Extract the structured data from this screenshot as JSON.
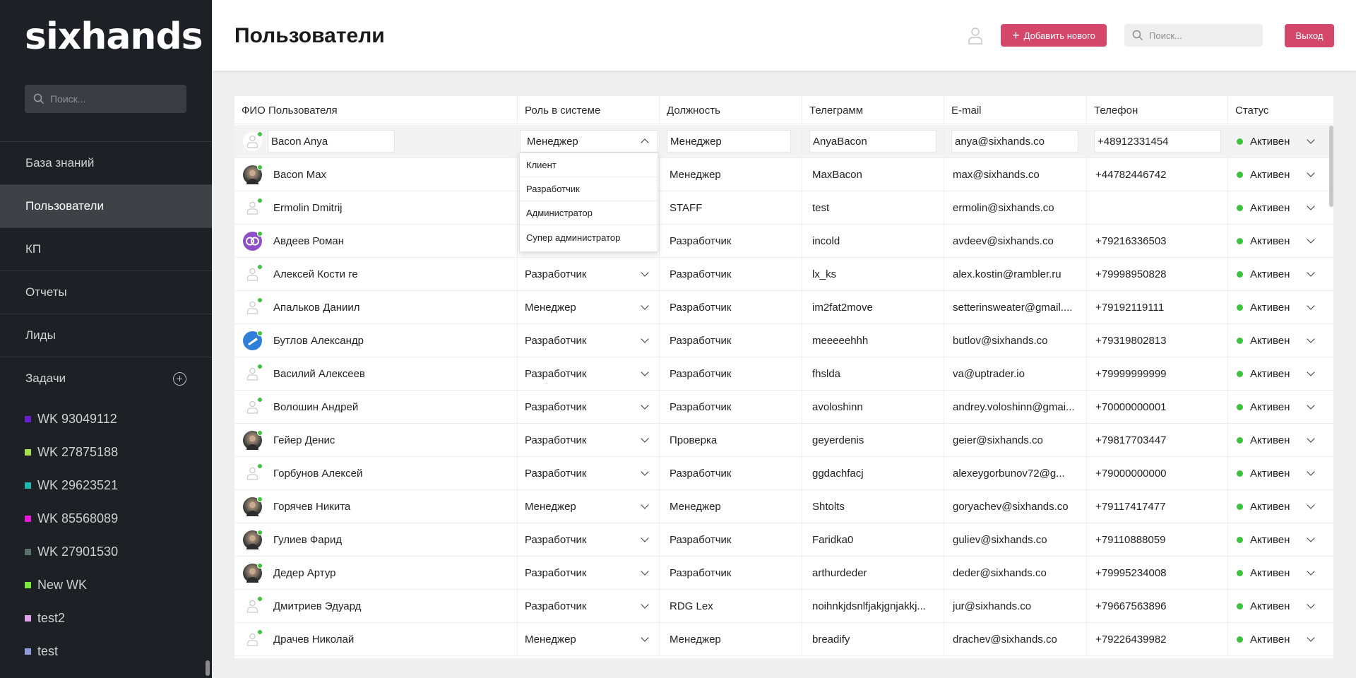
{
  "sidebar": {
    "logo": "sixhands",
    "search_placeholder": "Поиск...",
    "nav": [
      {
        "label": "База знаний",
        "active": false
      },
      {
        "label": "Пользователи",
        "active": true
      },
      {
        "label": "КП",
        "active": false
      },
      {
        "label": "Отчеты",
        "active": false
      },
      {
        "label": "Лиды",
        "active": false
      },
      {
        "label": "Задачи",
        "active": false
      }
    ],
    "tasks": [
      {
        "label": "WK 93049112",
        "color": "#6a1fd1"
      },
      {
        "label": "WK 27875188",
        "color": "#a7e04a"
      },
      {
        "label": "WK 29623521",
        "color": "#1fb5b0"
      },
      {
        "label": "WK 85568089",
        "color": "#e81ad9"
      },
      {
        "label": "WK 27901530",
        "color": "#5a7368"
      },
      {
        "label": "New WK",
        "color": "#7be83a"
      },
      {
        "label": "test2",
        "color": "#e0a3e8"
      },
      {
        "label": "test",
        "color": "#8e9bdc"
      }
    ]
  },
  "header": {
    "title": "Пользователи",
    "add_label": "Добавить нового",
    "search_placeholder": "Поиск...",
    "exit_label": "Выход",
    "accent": "#d5476a"
  },
  "table": {
    "columns": [
      "ФИО Пользователя",
      "Роль в системе",
      "Должность",
      "Телеграмм",
      "E-mail",
      "Телефон",
      "Статус"
    ],
    "rows": [
      {
        "name": "Bacon Anya",
        "role": "Менеджер",
        "position": "Менеджер",
        "telegram": "AnyaBacon",
        "email": "anya@sixhands.co",
        "phone": "+48912331454",
        "status": "Активен",
        "avatar": "blank"
      },
      {
        "name": "Bacon Max",
        "role": "",
        "position": "Менеджер",
        "telegram": "MaxBacon",
        "email": "max@sixhands.co",
        "phone": "+44782446742",
        "status": "Активен",
        "avatar": "photo"
      },
      {
        "name": "Ermolin Dmitrij",
        "role": "",
        "position": "STAFF",
        "telegram": "test",
        "email": "ermolin@sixhands.co",
        "phone": "",
        "status": "Активен",
        "avatar": "blank"
      },
      {
        "name": "Авдеев Роман",
        "role": "",
        "position": "Разработчик",
        "telegram": "incold",
        "email": "avdeev@sixhands.co",
        "phone": "+79216336503",
        "status": "Активен",
        "avatar": "logo"
      },
      {
        "name": "Алексей Кости ге",
        "role": "Разработчик",
        "position": "Разработчик",
        "telegram": "lx_ks",
        "email": "alex.kostin@rambler.ru",
        "phone": "+79998950828",
        "status": "Активен",
        "avatar": "blank"
      },
      {
        "name": "Апальков Даниил",
        "role": "Менеджер",
        "position": "Разработчик",
        "telegram": "im2fat2move",
        "email": "setterinsweater@gmail....",
        "phone": "+79192119111",
        "status": "Активен",
        "avatar": "blank"
      },
      {
        "name": "Бутлов Александр",
        "role": "Разработчик",
        "position": "Разработчик",
        "telegram": "meeeeehhh",
        "email": "butlov@sixhands.co",
        "phone": "+79319802813",
        "status": "Активен",
        "avatar": "blue"
      },
      {
        "name": "Василий Алексеев",
        "role": "Разработчик",
        "position": "Разработчик",
        "telegram": "fhslda",
        "email": "va@uptrader.io",
        "phone": "+79999999999",
        "status": "Активен",
        "avatar": "blank"
      },
      {
        "name": "Волошин Андрей",
        "role": "Разработчик",
        "position": "Разработчик",
        "telegram": "avoloshinn",
        "email": "andrey.voloshinn@gmai...",
        "phone": "+70000000001",
        "status": "Активен",
        "avatar": "blank"
      },
      {
        "name": "Гейер Денис",
        "role": "Разработчик",
        "position": "Проверка",
        "telegram": "geyerdenis",
        "email": "geier@sixhands.co",
        "phone": "+79817703447",
        "status": "Активен",
        "avatar": "photo"
      },
      {
        "name": "Горбунов Алексей",
        "role": "Разработчик",
        "position": "Разработчик",
        "telegram": "ggdachfacj",
        "email": "alexeygorbunov72@g...",
        "phone": "+79000000000",
        "status": "Активен",
        "avatar": "blank"
      },
      {
        "name": "Горячев Никита",
        "role": "Менеджер",
        "position": "Менеджер",
        "telegram": "Shtolts",
        "email": "goryachev@sixhands.co",
        "phone": "+79117417477",
        "status": "Активен",
        "avatar": "photo"
      },
      {
        "name": "Гулиев Фарид",
        "role": "Разработчик",
        "position": "Разработчик",
        "telegram": "Faridka0",
        "email": "guliev@sixhands.co",
        "phone": "+79110888059",
        "status": "Активен",
        "avatar": "photo"
      },
      {
        "name": "Дедер Артур",
        "role": "Разработчик",
        "position": "Разработчик",
        "telegram": "arthurdeder",
        "email": "deder@sixhands.co",
        "phone": "+79995234008",
        "status": "Активен",
        "avatar": "photo"
      },
      {
        "name": "Дмитриев Эдуард",
        "role": "Разработчик",
        "position": "RDG Lex",
        "telegram": "noihnkjdsnlfjakjgnjakkj...",
        "email": "jur@sixhands.co",
        "phone": "+79667563896",
        "status": "Активен",
        "avatar": "blank"
      },
      {
        "name": "Драчев Николай",
        "role": "Менеджер",
        "position": "Менеджер",
        "telegram": "breadify",
        "email": "drachev@sixhands.co",
        "phone": "+79226439982",
        "status": "Активен",
        "avatar": "blank"
      }
    ]
  },
  "role_dropdown": {
    "options": [
      "Клиент",
      "Разработчик",
      "Администратор",
      "Супер администратор"
    ]
  }
}
